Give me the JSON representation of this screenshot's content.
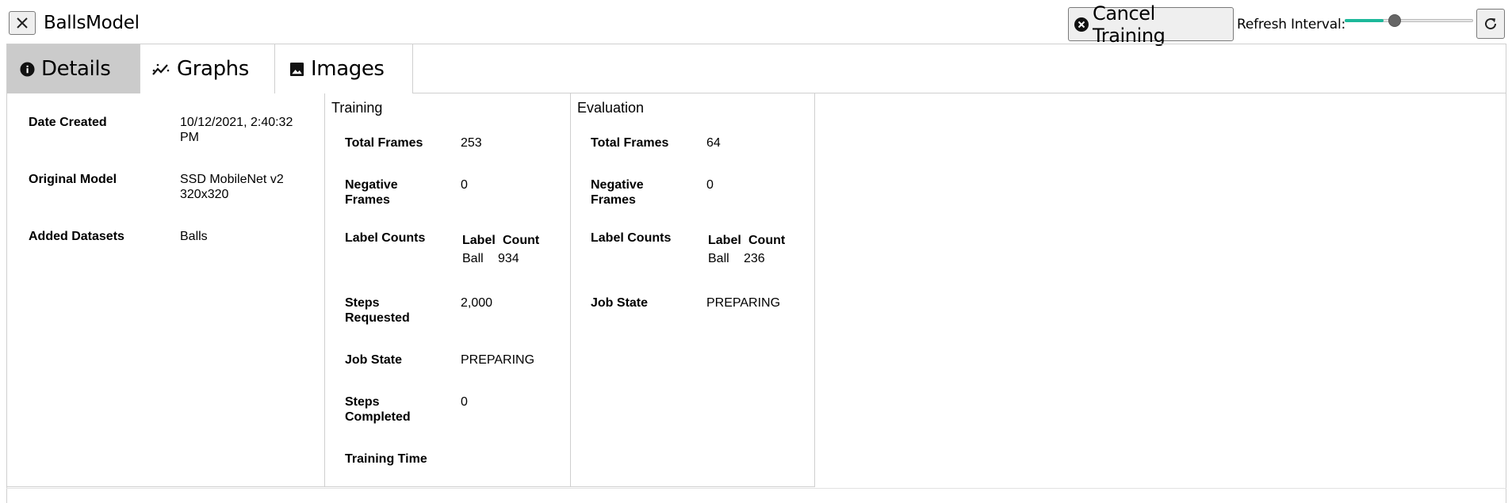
{
  "header": {
    "title": "BallsModel",
    "cancel_label": "Cancel Training",
    "refresh_label": "Refresh Interval:",
    "refresh_slider_fraction": 0.3,
    "accent_color": "#1db89a"
  },
  "tabs": [
    {
      "label": "Details",
      "icon": "info-icon",
      "active": true
    },
    {
      "label": "Graphs",
      "icon": "chart-icon",
      "active": false
    },
    {
      "label": "Images",
      "icon": "image-icon",
      "active": false
    }
  ],
  "general": {
    "date_created_label": "Date Created",
    "date_created_value": "10/12/2021, 2:40:32 PM",
    "original_model_label": "Original Model",
    "original_model_value": "SSD MobileNet v2 320x320",
    "added_datasets_label": "Added Datasets",
    "added_datasets_value": "Balls"
  },
  "training": {
    "title": "Training",
    "total_frames_label": "Total Frames",
    "total_frames_value": "253",
    "negative_frames_label": "Negative Frames",
    "negative_frames_value": "0",
    "label_counts_label": "Label Counts",
    "label_counts_headers": [
      "Label",
      "Count"
    ],
    "label_counts_rows": [
      {
        "label": "Ball",
        "count": "934"
      }
    ],
    "steps_requested_label": "Steps Requested",
    "steps_requested_value": "2,000",
    "job_state_label": "Job State",
    "job_state_value": "PREPARING",
    "steps_completed_label": "Steps Completed",
    "steps_completed_value": "0",
    "training_time_label": "Training Time",
    "training_time_value": ""
  },
  "evaluation": {
    "title": "Evaluation",
    "total_frames_label": "Total Frames",
    "total_frames_value": "64",
    "negative_frames_label": "Negative Frames",
    "negative_frames_value": "0",
    "label_counts_label": "Label Counts",
    "label_counts_headers": [
      "Label",
      "Count"
    ],
    "label_counts_rows": [
      {
        "label": "Ball",
        "count": "236"
      }
    ],
    "job_state_label": "Job State",
    "job_state_value": "PREPARING"
  }
}
